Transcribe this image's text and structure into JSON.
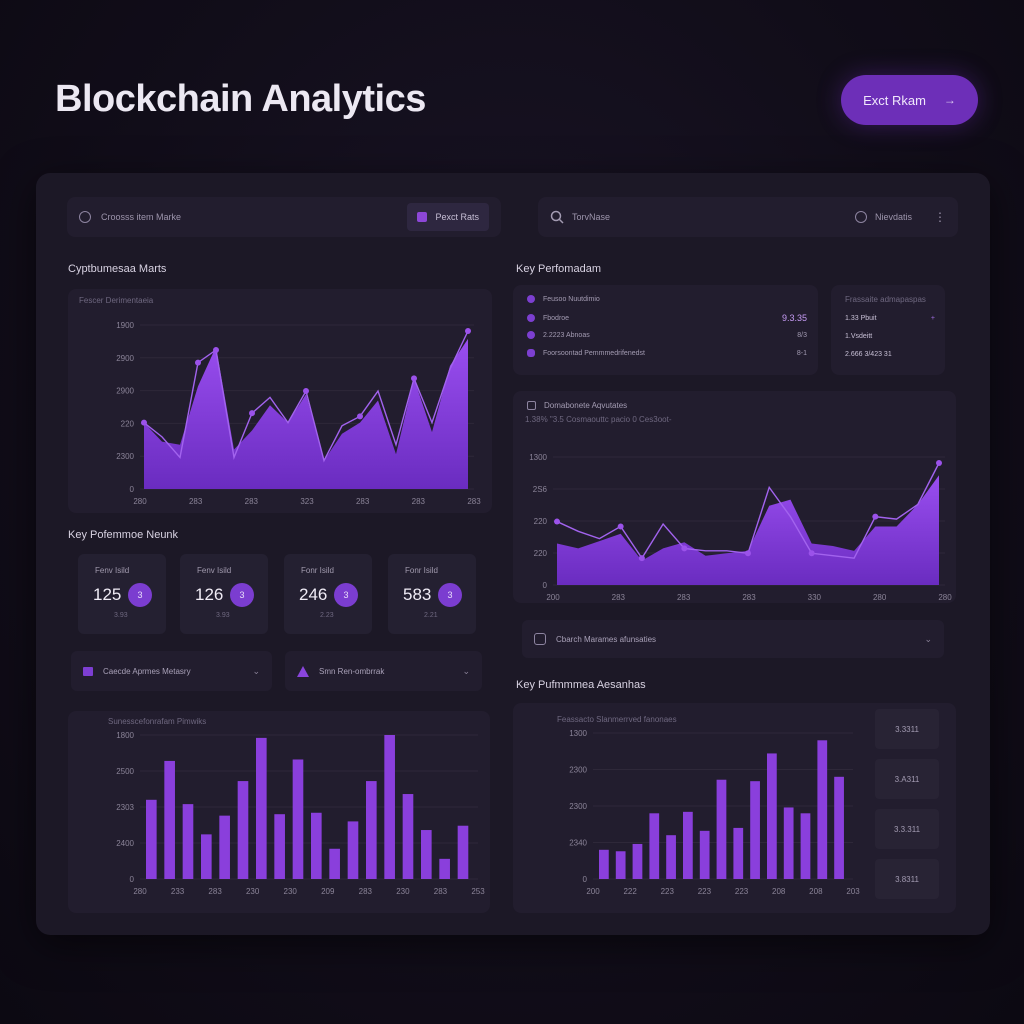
{
  "header": {
    "title": "Blockchain Analytics",
    "export_label": "Exct Rkam",
    "export_icon": "arrow-right-icon"
  },
  "toolbar": {
    "left_label": "Croosss item Marke",
    "left_chip": "Pexct Rats",
    "search_label": "TorvNase",
    "right_label": "Nievdatis"
  },
  "market_chart": {
    "title": "Cyptbumesaa Marts",
    "subtitle": "Fescer Derimentaeia"
  },
  "kpi_section": {
    "title": "Key Pofemmoe Neunk",
    "cards": [
      {
        "label": "Fenv Isild",
        "value": "125",
        "badge": "3",
        "sub": "3.93"
      },
      {
        "label": "Fenv Isild",
        "value": "126",
        "badge": "3",
        "sub": "3.93"
      },
      {
        "label": "Fonr Isild",
        "value": "246",
        "badge": "3",
        "sub": "2.23"
      },
      {
        "label": "Fonr Isild",
        "value": "583",
        "badge": "3",
        "sub": "2.21"
      }
    ]
  },
  "selects": {
    "left": "Caecde Aprmes Metasry",
    "right": "Smn Ren-ombrrak"
  },
  "left_bar_chart": {
    "subtitle": "Sunesscefonrafam Pimwiks"
  },
  "kpi_right": {
    "title": "Key Perfomadam",
    "rows": [
      {
        "label": "Feusoo Nuutdimio",
        "value": ""
      },
      {
        "label": "Fbodroe",
        "value": "9.3.35"
      },
      {
        "label": "2.2223 Abnoas",
        "value": "8/3"
      },
      {
        "label": "Foorsoontad Pemmmedrifenedst",
        "value": "8-1"
      }
    ],
    "side_title": "Frassaite admapaspas",
    "side_rows": [
      "1.33 Pbuit",
      "1.Vsdeitt",
      "2.666 3/423 31"
    ]
  },
  "right_line_chart": {
    "title": "Domabonete Aqvutates",
    "subtitle": "1.38%  \"3.5  Cosmaouttc pacio 0   Ces3oot-"
  },
  "right_select": "Cbarch Marames afunsaties",
  "right_bar_section": {
    "title": "Key Pufmmmea Aesanhas",
    "subtitle": "Feassacto Slanmerrved fanonaes",
    "stats": [
      "3.3311",
      "3.A311",
      "3.3.311",
      "3.8311"
    ]
  },
  "chart_data": [
    {
      "type": "area",
      "name": "market",
      "x_ticks": [
        "280",
        "283",
        "283",
        "323",
        "283",
        "283",
        "283"
      ],
      "y_ticks": [
        "1900",
        "2900",
        "2900",
        "220",
        "2300",
        "0"
      ],
      "values": [
        0.42,
        0.3,
        0.28,
        0.65,
        0.9,
        0.25,
        0.37,
        0.53,
        0.42,
        0.6,
        0.18,
        0.35,
        0.42,
        0.56,
        0.22,
        0.7,
        0.36,
        0.78,
        0.95
      ],
      "line_values": [
        0.42,
        0.33,
        0.2,
        0.8,
        0.88,
        0.2,
        0.48,
        0.58,
        0.42,
        0.62,
        0.18,
        0.4,
        0.46,
        0.62,
        0.28,
        0.7,
        0.42,
        0.76,
        1.0
      ]
    },
    {
      "type": "area",
      "name": "right-line",
      "x_ticks": [
        "200",
        "283",
        "283",
        "283",
        "330",
        "280",
        "280"
      ],
      "y_ticks": [
        "1300",
        "2S6",
        "220",
        "220",
        "0"
      ],
      "values": [
        0.34,
        0.3,
        0.36,
        0.42,
        0.2,
        0.3,
        0.35,
        0.24,
        0.26,
        0.28,
        0.65,
        0.7,
        0.34,
        0.32,
        0.28,
        0.48,
        0.48,
        0.66,
        0.9
      ],
      "line_values": [
        0.52,
        0.44,
        0.38,
        0.48,
        0.22,
        0.5,
        0.3,
        0.28,
        0.28,
        0.26,
        0.8,
        0.56,
        0.26,
        0.24,
        0.22,
        0.56,
        0.54,
        0.66,
        1.0
      ]
    },
    {
      "type": "bar",
      "name": "left-bars",
      "x_ticks": [
        "280",
        "233",
        "283",
        "230",
        "230",
        "209",
        "283",
        "230",
        "283",
        "253"
      ],
      "y_ticks": [
        "1800",
        "2500",
        "2303",
        "2400",
        "0"
      ],
      "values": [
        0.55,
        0.82,
        0.52,
        0.31,
        0.44,
        0.68,
        0.98,
        0.45,
        0.83,
        0.46,
        0.21,
        0.4,
        0.68,
        1.0,
        0.59,
        0.34,
        0.14,
        0.37
      ]
    },
    {
      "type": "bar",
      "name": "right-bars",
      "x_ticks": [
        "200",
        "222",
        "223",
        "223",
        "223",
        "208",
        "208",
        "203"
      ],
      "y_ticks": [
        "1300",
        "2300",
        "2300",
        "2340",
        "0"
      ],
      "values": [
        0.2,
        0.19,
        0.24,
        0.45,
        0.3,
        0.46,
        0.33,
        0.68,
        0.35,
        0.67,
        0.86,
        0.49,
        0.45,
        0.95,
        0.7
      ]
    }
  ]
}
